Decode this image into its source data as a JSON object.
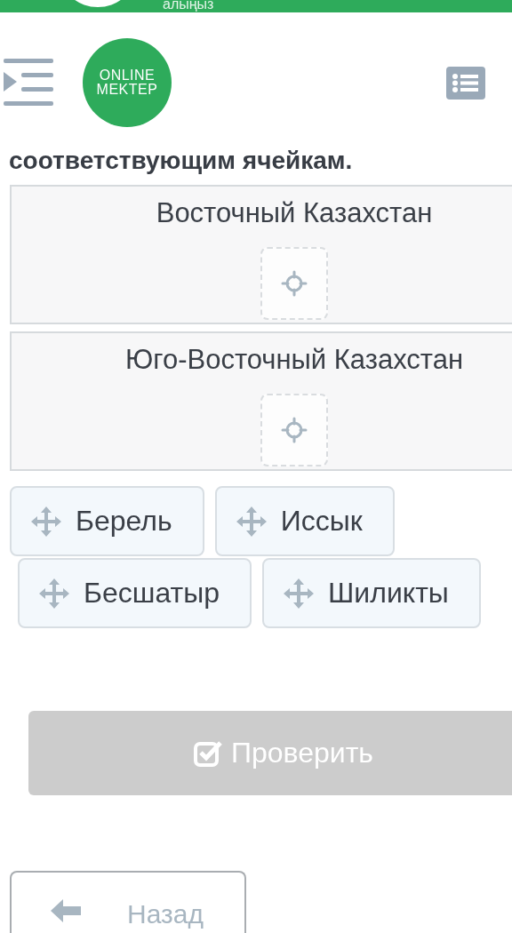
{
  "top_banner": {
    "text": "алыңыз"
  },
  "header": {
    "logo": {
      "line_1": "ONLINE",
      "line_2": "MEKTEP"
    }
  },
  "instruction": "соответствующим ячейкам.",
  "drop_zones": [
    {
      "title": "Восточный Казахстан"
    },
    {
      "title": "Юго-Восточный Казахстан"
    }
  ],
  "chip_rows": [
    {
      "chips": [
        "Берель",
        "Иссык"
      ]
    },
    {
      "chips": [
        "Бесшатыр",
        "Шиликты"
      ]
    }
  ],
  "check_button": {
    "label": "Проверить",
    "disabled": true
  },
  "back_button": {
    "label": "Назад"
  }
}
